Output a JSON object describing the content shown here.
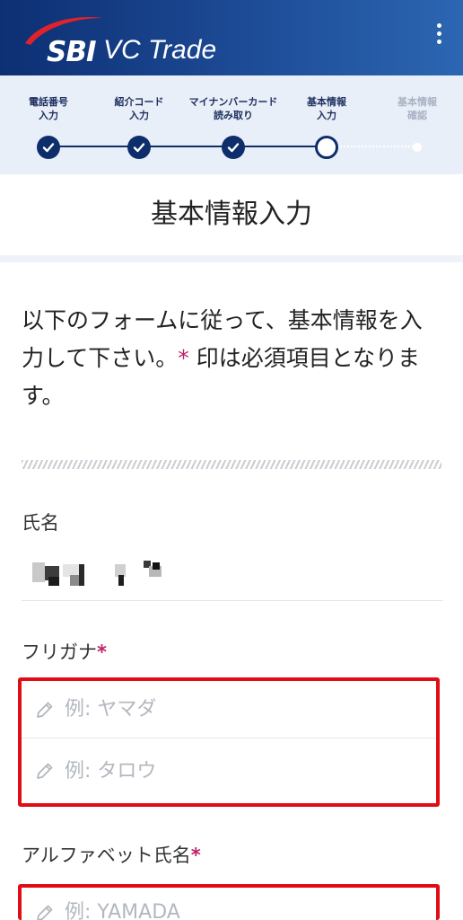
{
  "header": {
    "logo_sbi": "SBI",
    "logo_vc": "VC Trade",
    "menu_icon": "more-vertical-icon"
  },
  "stepper": {
    "steps": [
      {
        "label": "電話番号\n入力",
        "status": "done"
      },
      {
        "label": "紹介コード\n入力",
        "status": "done"
      },
      {
        "label": "マイナンバーカード\n読み取り",
        "status": "done"
      },
      {
        "label": "基本情報\n入力",
        "status": "current"
      },
      {
        "label": "基本情報\n確認",
        "status": "pending"
      }
    ]
  },
  "page": {
    "title": "基本情報入力",
    "intro_text": "以下のフォームに従って、基本情報を入力して下さい。",
    "intro_star": "*",
    "intro_required": " 印は必須項目となります。"
  },
  "form": {
    "name": {
      "label": "氏名"
    },
    "furigana": {
      "label": "フリガナ",
      "required_mark": "*",
      "last_placeholder": "例: ヤマダ",
      "first_placeholder": "例: タロウ"
    },
    "alphabet": {
      "label": "アルファベット氏名",
      "required_mark": "*",
      "last_placeholder": "例: YAMADA"
    }
  },
  "colors": {
    "header_dark": "#0d2f73",
    "header_light": "#2c66b2",
    "stepper_bg": "#e9eff8",
    "step_active": "#0e2d6b",
    "required": "#c0226a",
    "highlight_border": "#e00d17"
  }
}
